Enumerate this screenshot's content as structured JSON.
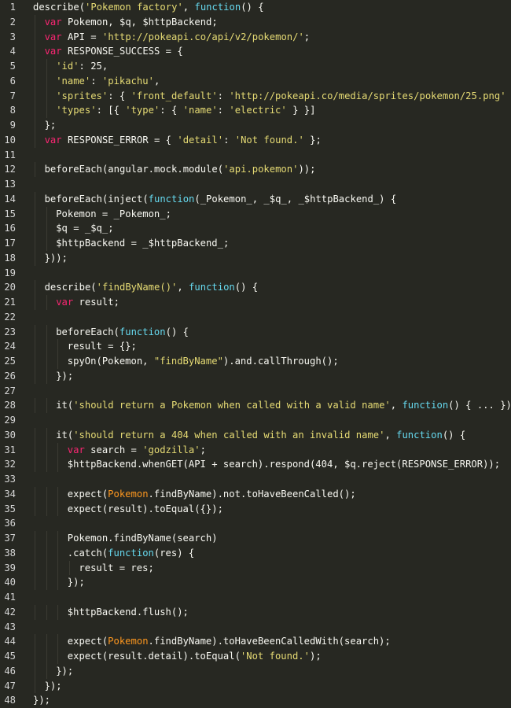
{
  "editor": {
    "colors": {
      "background": "#272822",
      "plain": "#f8f8f2",
      "string": "#e6db74",
      "keyword": "#f92672",
      "function_keyword": "#66d9ef",
      "object_highlight": "#fd971f",
      "line_number": "#d6d6d6"
    },
    "lines": [
      {
        "n": "1",
        "indent": 0,
        "tokens": [
          [
            "plain",
            "describe("
          ],
          [
            "str",
            "'Pokemon factory'"
          ],
          [
            "plain",
            ", "
          ],
          [
            "fn",
            "function"
          ],
          [
            "plain",
            "() {"
          ]
        ]
      },
      {
        "n": "2",
        "indent": 1,
        "tokens": [
          [
            "kw",
            "var"
          ],
          [
            "plain",
            " Pokemon, $q, $httpBackend;"
          ]
        ]
      },
      {
        "n": "3",
        "indent": 1,
        "tokens": [
          [
            "kw",
            "var"
          ],
          [
            "plain",
            " API = "
          ],
          [
            "str",
            "'http://pokeapi.co/api/v2/pokemon/'"
          ],
          [
            "plain",
            ";"
          ]
        ]
      },
      {
        "n": "4",
        "indent": 1,
        "tokens": [
          [
            "kw",
            "var"
          ],
          [
            "plain",
            " RESPONSE_SUCCESS = {"
          ]
        ]
      },
      {
        "n": "5",
        "indent": 2,
        "tokens": [
          [
            "str",
            "'id'"
          ],
          [
            "plain",
            ": 25,"
          ]
        ]
      },
      {
        "n": "6",
        "indent": 2,
        "tokens": [
          [
            "str",
            "'name'"
          ],
          [
            "plain",
            ": "
          ],
          [
            "str",
            "'pikachu'"
          ],
          [
            "plain",
            ","
          ]
        ]
      },
      {
        "n": "7",
        "indent": 2,
        "tokens": [
          [
            "str",
            "'sprites'"
          ],
          [
            "plain",
            ": { "
          ],
          [
            "str",
            "'front_default'"
          ],
          [
            "plain",
            ": "
          ],
          [
            "str",
            "'http://pokeapi.co/media/sprites/pokemon/25.png'"
          ],
          [
            "plain",
            " },"
          ]
        ]
      },
      {
        "n": "8",
        "indent": 2,
        "tokens": [
          [
            "str",
            "'types'"
          ],
          [
            "plain",
            ": [{ "
          ],
          [
            "str",
            "'type'"
          ],
          [
            "plain",
            ": { "
          ],
          [
            "str",
            "'name'"
          ],
          [
            "plain",
            ": "
          ],
          [
            "str",
            "'electric'"
          ],
          [
            "plain",
            " } }]"
          ]
        ]
      },
      {
        "n": "9",
        "indent": 1,
        "tokens": [
          [
            "plain",
            "};"
          ]
        ]
      },
      {
        "n": "10",
        "indent": 1,
        "tokens": [
          [
            "kw",
            "var"
          ],
          [
            "plain",
            " RESPONSE_ERROR = { "
          ],
          [
            "str",
            "'detail'"
          ],
          [
            "plain",
            ": "
          ],
          [
            "str",
            "'Not found.'"
          ],
          [
            "plain",
            " };"
          ]
        ]
      },
      {
        "n": "11",
        "indent": 0,
        "tokens": []
      },
      {
        "n": "12",
        "indent": 1,
        "tokens": [
          [
            "plain",
            "beforeEach(angular.mock.module("
          ],
          [
            "str",
            "'api.pokemon'"
          ],
          [
            "plain",
            "));"
          ]
        ]
      },
      {
        "n": "13",
        "indent": 0,
        "tokens": []
      },
      {
        "n": "14",
        "indent": 1,
        "tokens": [
          [
            "plain",
            "beforeEach(inject("
          ],
          [
            "fn",
            "function"
          ],
          [
            "plain",
            "(_Pokemon_, _$q_, _$httpBackend_) {"
          ]
        ]
      },
      {
        "n": "15",
        "indent": 2,
        "tokens": [
          [
            "plain",
            "Pokemon = _Pokemon_;"
          ]
        ]
      },
      {
        "n": "16",
        "indent": 2,
        "tokens": [
          [
            "plain",
            "$q = _$q_;"
          ]
        ]
      },
      {
        "n": "17",
        "indent": 2,
        "tokens": [
          [
            "plain",
            "$httpBackend = _$httpBackend_;"
          ]
        ]
      },
      {
        "n": "18",
        "indent": 1,
        "tokens": [
          [
            "plain",
            "}));"
          ]
        ]
      },
      {
        "n": "19",
        "indent": 0,
        "tokens": []
      },
      {
        "n": "20",
        "indent": 1,
        "tokens": [
          [
            "plain",
            "describe("
          ],
          [
            "str",
            "'findByName()'"
          ],
          [
            "plain",
            ", "
          ],
          [
            "fn",
            "function"
          ],
          [
            "plain",
            "() {"
          ]
        ]
      },
      {
        "n": "21",
        "indent": 2,
        "tokens": [
          [
            "kw",
            "var"
          ],
          [
            "plain",
            " result;"
          ]
        ]
      },
      {
        "n": "22",
        "indent": 0,
        "tokens": []
      },
      {
        "n": "23",
        "indent": 2,
        "tokens": [
          [
            "plain",
            "beforeEach("
          ],
          [
            "fn",
            "function"
          ],
          [
            "plain",
            "() {"
          ]
        ]
      },
      {
        "n": "24",
        "indent": 3,
        "tokens": [
          [
            "plain",
            "result = {};"
          ]
        ]
      },
      {
        "n": "25",
        "indent": 3,
        "tokens": [
          [
            "plain",
            "spyOn(Pokemon, "
          ],
          [
            "str",
            "\"findByName\""
          ],
          [
            "plain",
            ").and.callThrough();"
          ]
        ]
      },
      {
        "n": "26",
        "indent": 2,
        "tokens": [
          [
            "plain",
            "});"
          ]
        ]
      },
      {
        "n": "27",
        "indent": 0,
        "tokens": []
      },
      {
        "n": "28",
        "indent": 2,
        "tokens": [
          [
            "plain",
            "it("
          ],
          [
            "str",
            "'should return a Pokemon when called with a valid name'"
          ],
          [
            "plain",
            ", "
          ],
          [
            "fn",
            "function"
          ],
          [
            "plain",
            "() { ... });"
          ]
        ]
      },
      {
        "n": "29",
        "indent": 0,
        "tokens": []
      },
      {
        "n": "30",
        "indent": 2,
        "tokens": [
          [
            "plain",
            "it("
          ],
          [
            "str",
            "'should return a 404 when called with an invalid name'"
          ],
          [
            "plain",
            ", "
          ],
          [
            "fn",
            "function"
          ],
          [
            "plain",
            "() {"
          ]
        ]
      },
      {
        "n": "31",
        "indent": 3,
        "tokens": [
          [
            "kw",
            "var"
          ],
          [
            "plain",
            " search = "
          ],
          [
            "str",
            "'godzilla'"
          ],
          [
            "plain",
            ";"
          ]
        ]
      },
      {
        "n": "32",
        "indent": 3,
        "tokens": [
          [
            "plain",
            "$httpBackend.whenGET(API + search).respond(404, $q.reject(RESPONSE_ERROR));"
          ]
        ]
      },
      {
        "n": "33",
        "indent": 0,
        "tokens": []
      },
      {
        "n": "34",
        "indent": 3,
        "tokens": [
          [
            "plain",
            "expect("
          ],
          [
            "cls",
            "Pokemon"
          ],
          [
            "plain",
            ".findByName).not.toHaveBeenCalled();"
          ]
        ]
      },
      {
        "n": "35",
        "indent": 3,
        "tokens": [
          [
            "plain",
            "expect(result).toEqual({});"
          ]
        ]
      },
      {
        "n": "36",
        "indent": 0,
        "tokens": []
      },
      {
        "n": "37",
        "indent": 3,
        "tokens": [
          [
            "plain",
            "Pokemon.findByName(search)"
          ]
        ]
      },
      {
        "n": "38",
        "indent": 3,
        "tokens": [
          [
            "plain",
            ".catch("
          ],
          [
            "fn",
            "function"
          ],
          [
            "plain",
            "(res) {"
          ]
        ]
      },
      {
        "n": "39",
        "indent": 4,
        "tokens": [
          [
            "plain",
            "result = res;"
          ]
        ]
      },
      {
        "n": "40",
        "indent": 3,
        "tokens": [
          [
            "plain",
            "});"
          ]
        ]
      },
      {
        "n": "41",
        "indent": 0,
        "tokens": []
      },
      {
        "n": "42",
        "indent": 3,
        "tokens": [
          [
            "plain",
            "$httpBackend.flush();"
          ]
        ]
      },
      {
        "n": "43",
        "indent": 0,
        "tokens": []
      },
      {
        "n": "44",
        "indent": 3,
        "tokens": [
          [
            "plain",
            "expect("
          ],
          [
            "cls",
            "Pokemon"
          ],
          [
            "plain",
            ".findByName).toHaveBeenCalledWith(search);"
          ]
        ]
      },
      {
        "n": "45",
        "indent": 3,
        "tokens": [
          [
            "plain",
            "expect(result.detail).toEqual("
          ],
          [
            "str",
            "'Not found.'"
          ],
          [
            "plain",
            ");"
          ]
        ]
      },
      {
        "n": "46",
        "indent": 2,
        "tokens": [
          [
            "plain",
            "});"
          ]
        ]
      },
      {
        "n": "47",
        "indent": 1,
        "tokens": [
          [
            "plain",
            "});"
          ]
        ]
      },
      {
        "n": "48",
        "indent": 0,
        "tokens": [
          [
            "plain",
            "});"
          ]
        ]
      }
    ]
  }
}
